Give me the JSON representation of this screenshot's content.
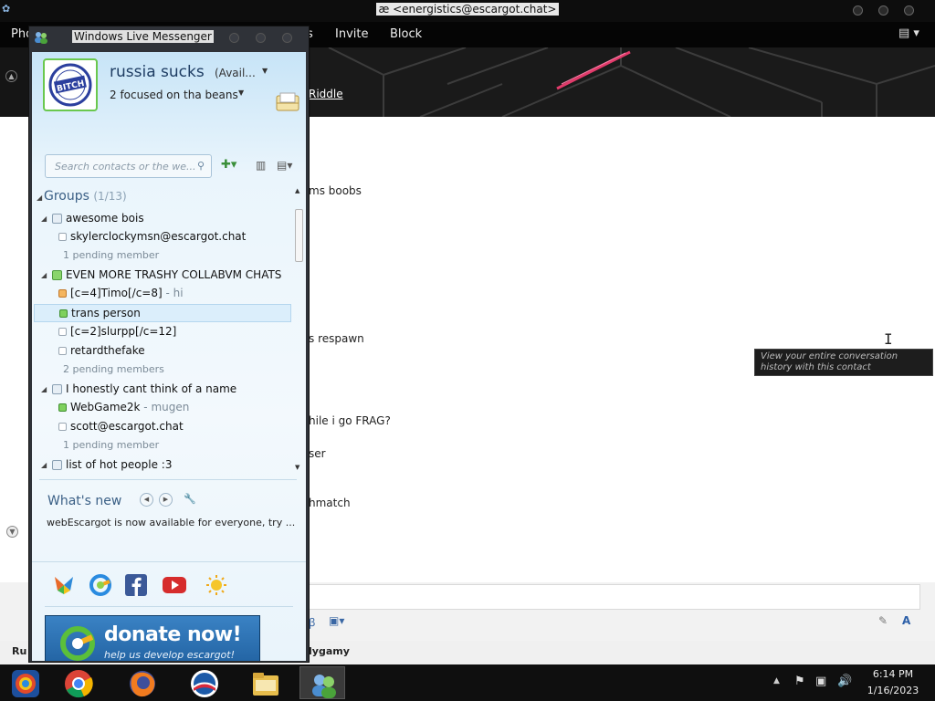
{
  "chat": {
    "title": "æ <energistics@escargot.chat>",
    "menu": {
      "partial_left": "Pho",
      "partial_mid": "s",
      "invite": "Invite",
      "block": "Block"
    },
    "header_link": "Riddle",
    "messages": [
      "ms boobs",
      "s respawn",
      "hile i go FRAG?",
      "ser",
      "hmatch"
    ],
    "tooltip": "View your entire conversation history with this contact",
    "status_left": "Ru",
    "status_right": "lygamy"
  },
  "messenger": {
    "title": "Windows Live Messenger",
    "profile": {
      "name": "russia sucks",
      "status": "(Avail...",
      "psm": "2 focused on tha beans",
      "pic_text": "BITCH"
    },
    "search_placeholder": "Search contacts or the we...",
    "groups_label": "Groups",
    "groups_count": "(1/13)",
    "groups": [
      {
        "name": "awesome bois",
        "contacts": [
          {
            "name": "skylerclockymsn@escargot.chat",
            "psm": "",
            "status": "offline"
          }
        ],
        "pending": "1 pending member"
      },
      {
        "name": "EVEN MORE TRASHY COLLABVM CHATS",
        "contacts": [
          {
            "name": "[c=4]Timo[/c=8]",
            "psm": " - hi",
            "status": "away"
          },
          {
            "name": "trans person",
            "psm": "",
            "status": "online"
          },
          {
            "name": "[c=2]slurpp[/c=12]",
            "psm": "",
            "status": "offline"
          },
          {
            "name": "retardthefake",
            "psm": "",
            "status": "offline"
          }
        ],
        "pending": "2 pending members"
      },
      {
        "name": "I honestly cant think of a name",
        "contacts": [
          {
            "name": "WebGame2k",
            "psm": " - mugen",
            "status": "online"
          },
          {
            "name": "scott@escargot.chat",
            "psm": "",
            "status": "offline"
          }
        ],
        "pending": "1 pending member"
      },
      {
        "name": "list of hot people :3"
      }
    ],
    "whats_new": {
      "title": "What's new",
      "text": "webEscargot is now available for everyone, try ..."
    },
    "donate": {
      "title": "donate now!",
      "subtitle": "help us develop escargot!"
    }
  },
  "taskbar": {
    "apps": [
      "start-button",
      "chrome",
      "firefox",
      "obama-app",
      "file-explorer",
      "messenger"
    ],
    "time": "6:14 PM",
    "date": "1/16/2023"
  },
  "colors": {
    "messenger_bg": "#eaf5fc",
    "online": "#7fd15e",
    "away": "#f4b660",
    "donate": "#2b70b2"
  }
}
